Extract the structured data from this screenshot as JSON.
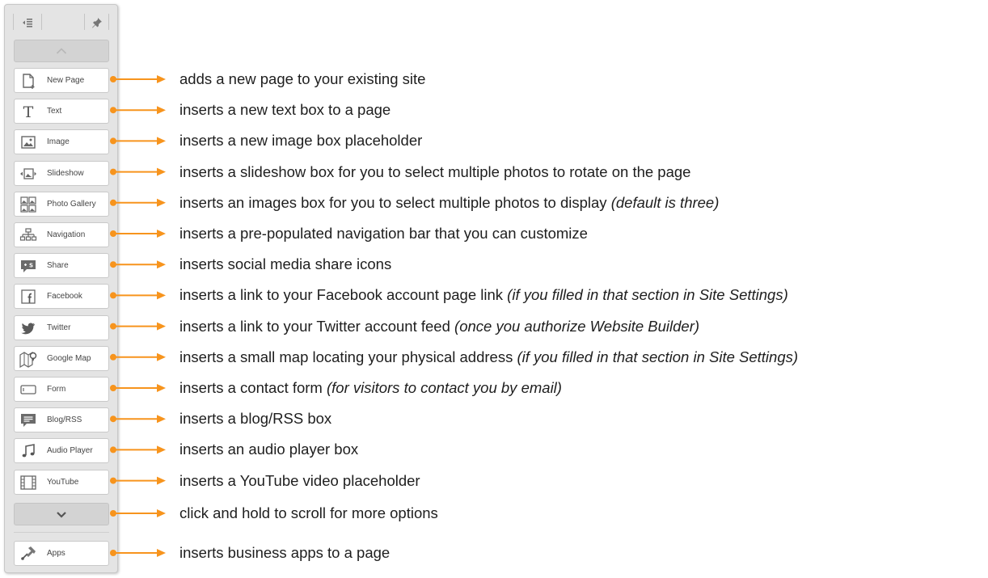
{
  "colors": {
    "arrow": "#f7941d",
    "panel": "#e4e4e4"
  },
  "toolbar": {
    "top_icons": [
      "collapse-panel-icon",
      "pin-icon"
    ],
    "scroll_up_icon": "chevron-up-icon",
    "scroll_down_icon": "chevron-down-icon",
    "items": [
      {
        "label": "New Page",
        "icon": "new-page-icon"
      },
      {
        "label": "Text",
        "icon": "text-icon"
      },
      {
        "label": "Image",
        "icon": "image-icon"
      },
      {
        "label": "Slideshow",
        "icon": "slideshow-icon"
      },
      {
        "label": "Photo Gallery",
        "icon": "photo-gallery-icon"
      },
      {
        "label": "Navigation",
        "icon": "navigation-icon"
      },
      {
        "label": "Share",
        "icon": "share-icon"
      },
      {
        "label": "Facebook",
        "icon": "facebook-icon"
      },
      {
        "label": "Twitter",
        "icon": "twitter-icon"
      },
      {
        "label": "Google Map",
        "icon": "google-map-icon"
      },
      {
        "label": "Form",
        "icon": "form-icon"
      },
      {
        "label": "Blog/RSS",
        "icon": "blog-rss-icon"
      },
      {
        "label": "Audio Player",
        "icon": "audio-player-icon"
      },
      {
        "label": "YouTube",
        "icon": "youtube-icon"
      }
    ],
    "apps": {
      "label": "Apps",
      "icon": "apps-icon"
    }
  },
  "descriptions": [
    {
      "text": "adds a new page to your existing site",
      "note": ""
    },
    {
      "text": "inserts a new text box to a page",
      "note": ""
    },
    {
      "text": "inserts a new image box placeholder",
      "note": ""
    },
    {
      "text": "inserts a slideshow box for you to select multiple photos to rotate on the page",
      "note": ""
    },
    {
      "text": "inserts an images box for you to select multiple photos to display ",
      "note": "(default is three)"
    },
    {
      "text": "inserts a pre-populated navigation bar that you can customize",
      "note": ""
    },
    {
      "text": "inserts social media share icons",
      "note": ""
    },
    {
      "text": "inserts a link to your Facebook account page link ",
      "note": "(if you filled in that section in Site Settings)"
    },
    {
      "text": "inserts a link to your Twitter account feed ",
      "note": "(once you authorize Website Builder)"
    },
    {
      "text": "inserts a small map locating your physical address ",
      "note": "(if you filled in that section in Site Settings)"
    },
    {
      "text": "inserts a contact form ",
      "note": "(for visitors to contact you by email)"
    },
    {
      "text": "inserts a blog/RSS box",
      "note": ""
    },
    {
      "text": "inserts an audio player box",
      "note": ""
    },
    {
      "text": "inserts a YouTube video placeholder",
      "note": ""
    },
    {
      "text": "click and hold to scroll for more options",
      "note": ""
    },
    {
      "text": "inserts business apps to a page",
      "note": ""
    }
  ]
}
